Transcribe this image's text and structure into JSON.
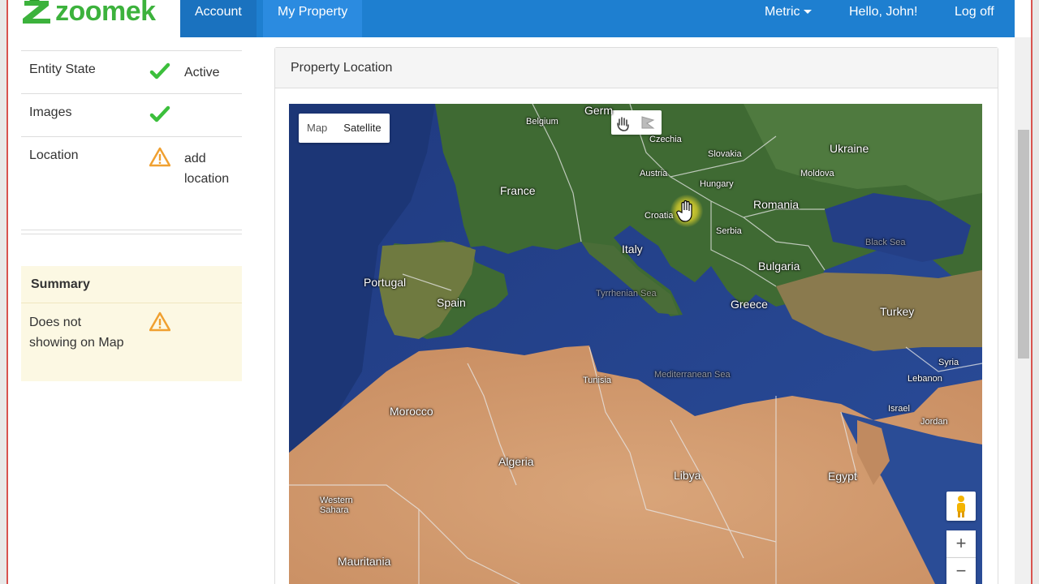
{
  "brand": {
    "name": "zoomek"
  },
  "nav": {
    "account": "Account",
    "my_property": "My Property",
    "metric": "Metric",
    "hello": "Hello, John!",
    "logoff": "Log off"
  },
  "status": {
    "rows": [
      {
        "label": "Entity State",
        "icon": "check-icon",
        "value": "Active"
      },
      {
        "label": "Images",
        "icon": "check-icon",
        "value": ""
      },
      {
        "label": "Location",
        "icon": "warning-icon",
        "value": "add location"
      }
    ]
  },
  "summary": {
    "title": "Summary",
    "message": "Does not showing on Map",
    "icon": "warning-icon"
  },
  "panel": {
    "title": "Property Location"
  },
  "map": {
    "type_map": "Map",
    "type_satellite": "Satellite",
    "zoom_in": "+",
    "zoom_out": "−",
    "labels": {
      "germany": "Germ",
      "belgium": "Belgium",
      "czechia": "Czechia",
      "slovakia": "Slovakia",
      "ukraine": "Ukraine",
      "austria": "Austria",
      "hungary": "Hungary",
      "moldova": "Moldova",
      "france": "France",
      "romania": "Romania",
      "croatia": "Croatia",
      "serbia": "Serbia",
      "italy": "Italy",
      "bulgaria": "Bulgaria",
      "black_sea": "Black Sea",
      "portugal": "Portugal",
      "spain": "Spain",
      "greece": "Greece",
      "turkey": "Turkey",
      "tyrrhenian": "Tyrrhenian Sea",
      "tunisia": "Tunisia",
      "mediterranean": "Mediterranean Sea",
      "syria": "Syria",
      "lebanon": "Lebanon",
      "israel": "Israel",
      "jordan": "Jordan",
      "morocco": "Morocco",
      "algeria": "Algeria",
      "libya": "Libya",
      "egypt": "Egypt",
      "western_sahara": "Western Sahara",
      "mauritania": "Mauritania"
    }
  },
  "colors": {
    "nav_blue": "#1e7fd0",
    "brand_green": "#3cb23c",
    "check_green": "#3cbf3c",
    "warning_orange": "#f0a030",
    "summary_bg": "#fcf8e3"
  }
}
